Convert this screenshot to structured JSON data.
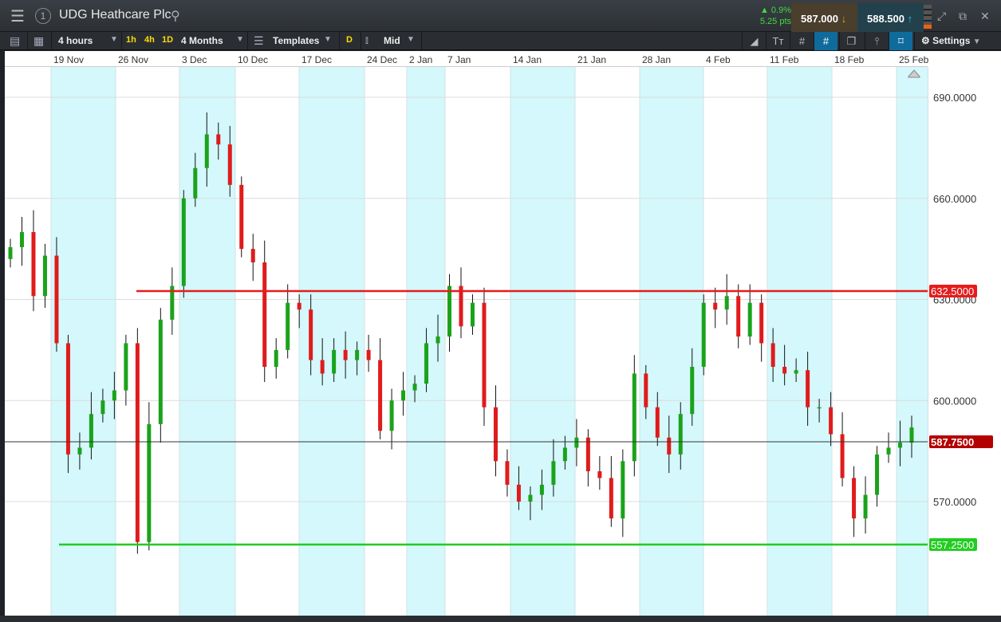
{
  "header": {
    "instrument": "UDG Heathcare Plc",
    "badge": "1",
    "change_pct": "▲ 0.9%",
    "change_pts": "5.25 pts",
    "sell_price": "587.000",
    "buy_price": "588.500"
  },
  "toolbar": {
    "interval": "4 hours",
    "quick": [
      "1h",
      "4h",
      "1D"
    ],
    "range": "4 Months",
    "templates": "Templates",
    "d_label": "D",
    "price_type": "Mid",
    "settings": "Settings"
  },
  "colors": {
    "up": "#1aa31a",
    "down": "#e01b1b",
    "resistance": "#e61c1c",
    "support": "#22cc22",
    "last": "#b30000",
    "shade": "#d4f8fb"
  },
  "chart_data": {
    "type": "candlestick",
    "x_ticks": [
      "19 Nov",
      "26 Nov",
      "3 Dec",
      "10 Dec",
      "17 Dec",
      "24 Dec",
      "2 Jan",
      "7 Jan",
      "14 Jan",
      "21 Jan",
      "28 Jan",
      "4 Feb",
      "11 Feb",
      "18 Feb",
      "25 Feb"
    ],
    "y_ticks": [
      "690.0000",
      "660.0000",
      "630.0000",
      "600.0000",
      "570.0000"
    ],
    "y_tick_values": [
      690,
      660,
      630,
      600,
      570
    ],
    "ylim": [
      548,
      700
    ],
    "levels": [
      {
        "name": "resistance",
        "value": 632.5,
        "label": "632.5000"
      },
      {
        "name": "support",
        "value": 557.25,
        "label": "557.2500"
      },
      {
        "name": "last",
        "value": 587.75,
        "label": "587.7500"
      }
    ],
    "closes": [
      645.5,
      650,
      631,
      643,
      617,
      584,
      586,
      596,
      600,
      603,
      617,
      558,
      593,
      624,
      634,
      660,
      669,
      679,
      676,
      664,
      645,
      641,
      610,
      615,
      629,
      627,
      612,
      608,
      615,
      612,
      615,
      612,
      591,
      600,
      603,
      605,
      617,
      619,
      634,
      622,
      629,
      598,
      582,
      575,
      570,
      572,
      575,
      582,
      586,
      589,
      579,
      577,
      565,
      582,
      608,
      598,
      589,
      584,
      596,
      610,
      629,
      627,
      631,
      619,
      629,
      617,
      610,
      608,
      609,
      598,
      598,
      590,
      577,
      565,
      572,
      584,
      586,
      587.5,
      592
    ],
    "open_first": 642
  }
}
